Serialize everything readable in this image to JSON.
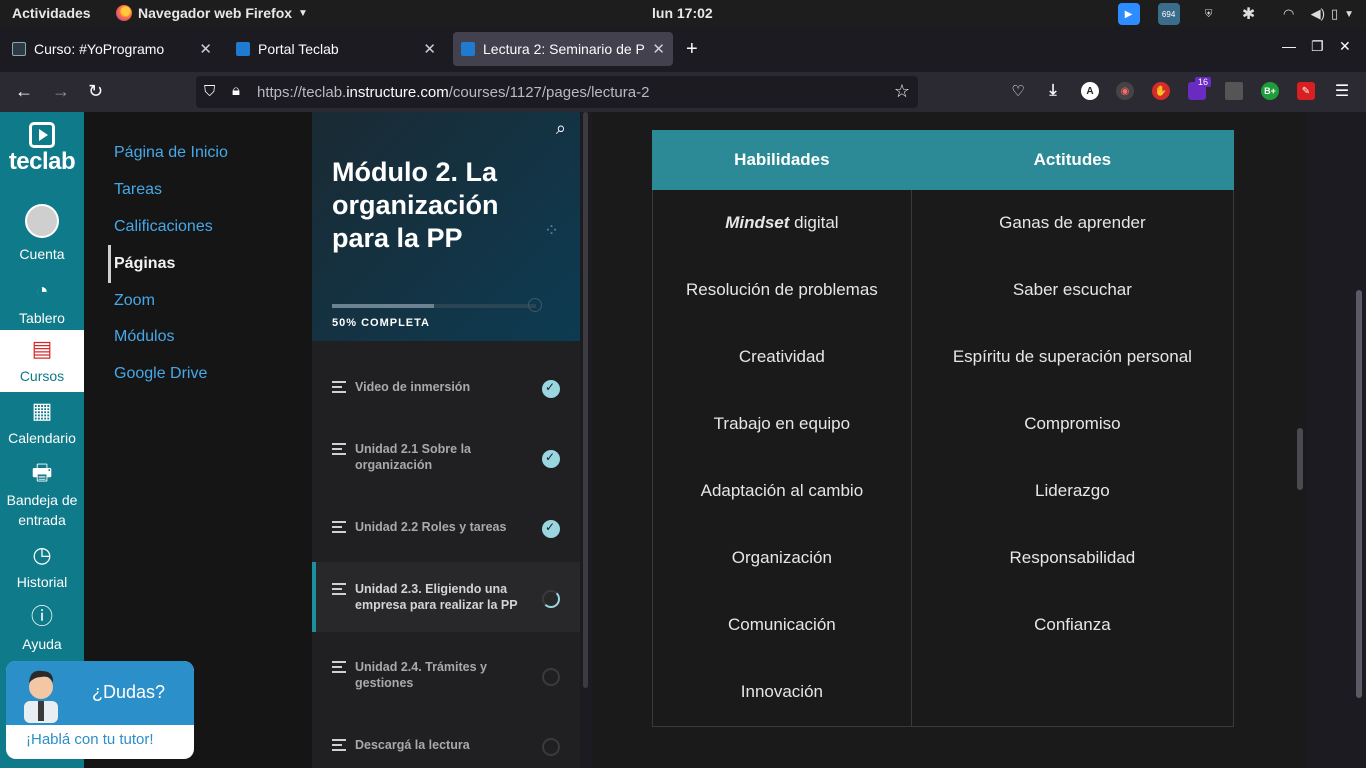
{
  "os_bar": {
    "activities": "Actividades",
    "app_name": "Navegador web Firefox",
    "clock": "lun 17:02",
    "tray_badge": "694"
  },
  "browser": {
    "tabs": [
      {
        "title": "Curso: #YoProgramo",
        "active": false
      },
      {
        "title": "Portal Teclab",
        "active": false
      },
      {
        "title": "Lectura 2: Seminario de P",
        "active": true
      }
    ],
    "url_prefix": "https://teclab.",
    "url_domain": "instructure.com",
    "url_path": "/courses/1127/pages/lectura-2",
    "ext_badge": "16"
  },
  "global_nav": {
    "logo_text": "teclab",
    "items": [
      {
        "label": "Cuenta",
        "icon": "user-icon"
      },
      {
        "label": "Tablero",
        "icon": "dashboard-icon"
      },
      {
        "label": "Cursos",
        "icon": "book-icon"
      },
      {
        "label": "Calendario",
        "icon": "calendar-icon"
      },
      {
        "label": "Bandeja de entrada",
        "icon": "inbox-icon"
      },
      {
        "label": "Historial",
        "icon": "clock-icon"
      },
      {
        "label": "Ayuda",
        "icon": "help-icon"
      }
    ]
  },
  "course_nav": {
    "items": [
      {
        "label": "Página de Inicio"
      },
      {
        "label": "Tareas"
      },
      {
        "label": "Calificaciones"
      },
      {
        "label": "Páginas"
      },
      {
        "label": "Zoom"
      },
      {
        "label": "Módulos"
      },
      {
        "label": "Google Drive"
      }
    ],
    "current": "Páginas"
  },
  "module": {
    "title": "Módulo 2. La organización para la PP",
    "progress_label": "50% COMPLETA",
    "progress": 0.5,
    "items": [
      {
        "label": "Video de inmersión",
        "status": "done"
      },
      {
        "label": "Unidad 2.1 Sobre la organización",
        "status": "done"
      },
      {
        "label": "Unidad 2.2 Roles y tareas",
        "status": "done"
      },
      {
        "label": "Unidad 2.3. Eligiendo una empresa para realizar la PP",
        "status": "in-progress"
      },
      {
        "label": "Unidad 2.4. Trámites y gestiones",
        "status": "pending"
      },
      {
        "label": "Descargá la lectura",
        "status": "pending"
      }
    ]
  },
  "table": {
    "headers": [
      "Habilidades",
      "Actitudes"
    ],
    "rows": [
      {
        "skill_em": "Mindset",
        "skill": " digital",
        "attitude": "Ganas de aprender"
      },
      {
        "skill_em": "",
        "skill": "Resolución de problemas",
        "attitude": "Saber escuchar"
      },
      {
        "skill_em": "",
        "skill": "Creatividad",
        "attitude": "Espíritu de superación personal"
      },
      {
        "skill_em": "",
        "skill": "Trabajo en equipo",
        "attitude": "Compromiso"
      },
      {
        "skill_em": "",
        "skill": "Adaptación al cambio",
        "attitude": "Liderazgo"
      },
      {
        "skill_em": "",
        "skill": "Organización",
        "attitude": "Responsabilidad"
      },
      {
        "skill_em": "",
        "skill": "Comunicación",
        "attitude": "Confianza"
      },
      {
        "skill_em": "",
        "skill": "Innovación",
        "attitude": ""
      }
    ]
  },
  "chat": {
    "question": "¿Dudas?",
    "link": "¡Hablá con tu tutor!"
  }
}
